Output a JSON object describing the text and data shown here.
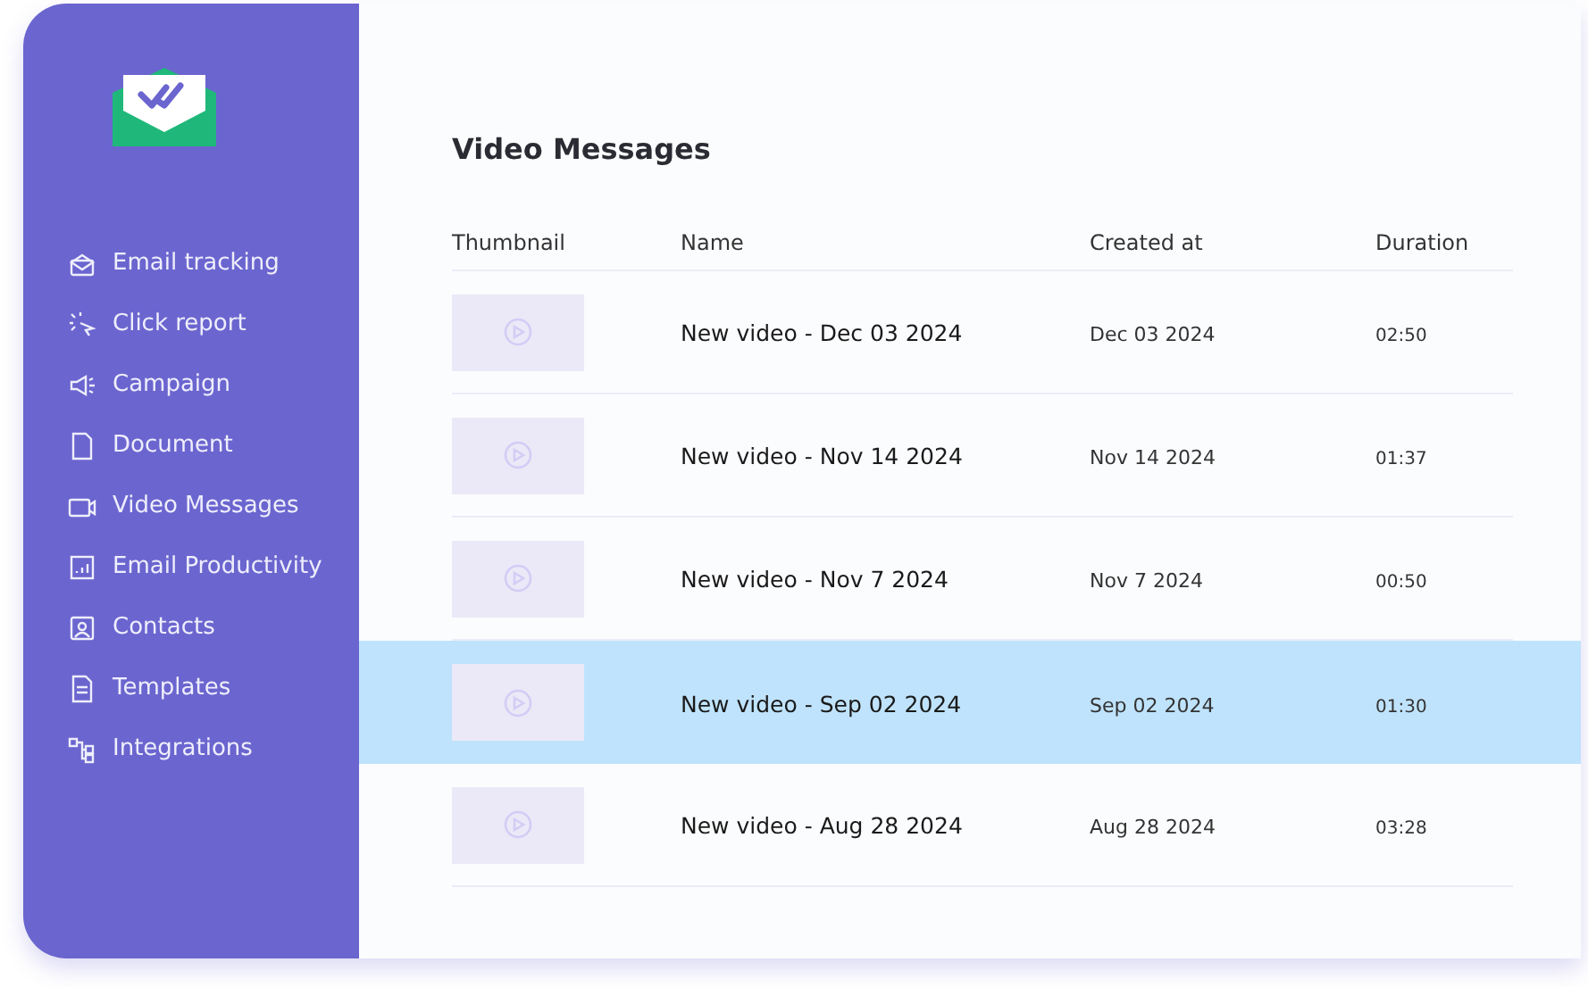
{
  "sidebar": {
    "items": [
      {
        "label": "Email tracking"
      },
      {
        "label": "Click report"
      },
      {
        "label": "Campaign"
      },
      {
        "label": "Document"
      },
      {
        "label": "Video Messages"
      },
      {
        "label": "Email Productivity"
      },
      {
        "label": "Contacts"
      },
      {
        "label": "Templates"
      },
      {
        "label": "Integrations"
      }
    ]
  },
  "page_title": "Video Messages",
  "table": {
    "columns": [
      "Thumbnail",
      "Name",
      "Created at",
      "Duration"
    ],
    "rows": [
      {
        "name": "New video - Dec 03 2024",
        "created_at": "Dec 03 2024",
        "duration": "02:50",
        "selected": false
      },
      {
        "name": "New video - Nov 14 2024",
        "created_at": "Nov 14 2024",
        "duration": "01:37",
        "selected": false
      },
      {
        "name": "New video - Nov 7 2024",
        "created_at": "Nov 7 2024",
        "duration": "00:50",
        "selected": false
      },
      {
        "name": "New video - Sep 02 2024",
        "created_at": "Sep 02 2024",
        "duration": "01:30",
        "selected": true
      },
      {
        "name": "New video - Aug 28 2024",
        "created_at": "Aug 28 2024",
        "duration": "03:28",
        "selected": false
      }
    ]
  }
}
